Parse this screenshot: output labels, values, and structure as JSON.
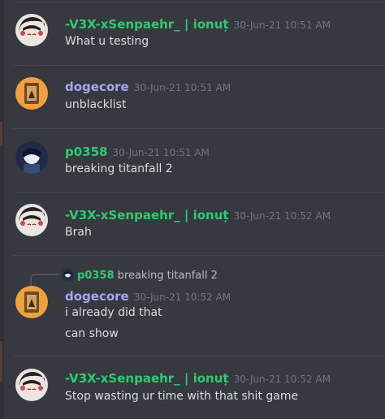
{
  "colors": {
    "background": "#36393f",
    "name_green": "#2ecc71",
    "name_purple": "#a3a8f5",
    "text": "#dcddde",
    "timestamp": "#72767d",
    "reply_text": "#b9bbbe"
  },
  "messages": [
    {
      "author": "-V3X-xSenpaehr_ | ionuț",
      "timestamp": "30-Jun-21 10:51 AM",
      "lines": [
        "What u testing"
      ]
    },
    {
      "author": "dogecore",
      "timestamp": "30-Jun-21 10:51 AM",
      "lines": [
        "unblacklist"
      ]
    },
    {
      "author": "p0358",
      "timestamp": "30-Jun-21 10:51 AM",
      "lines": [
        "breaking titanfall 2"
      ]
    },
    {
      "author": "-V3X-xSenpaehr_ | ionuț",
      "timestamp": "30-Jun-21 10:52 AM",
      "lines": [
        "Brah"
      ]
    },
    {
      "reply_to": {
        "author": "p0358",
        "text": "breaking titanfall 2"
      },
      "author": "dogecore",
      "timestamp": "30-Jun-21 10:52 AM",
      "lines": [
        "i already did that",
        "can show"
      ]
    },
    {
      "author": "-V3X-xSenpaehr_ | ionuț",
      "timestamp": "30-Jun-21 10:52 AM",
      "lines": [
        "Stop wasting ur time with that shit game"
      ]
    }
  ]
}
